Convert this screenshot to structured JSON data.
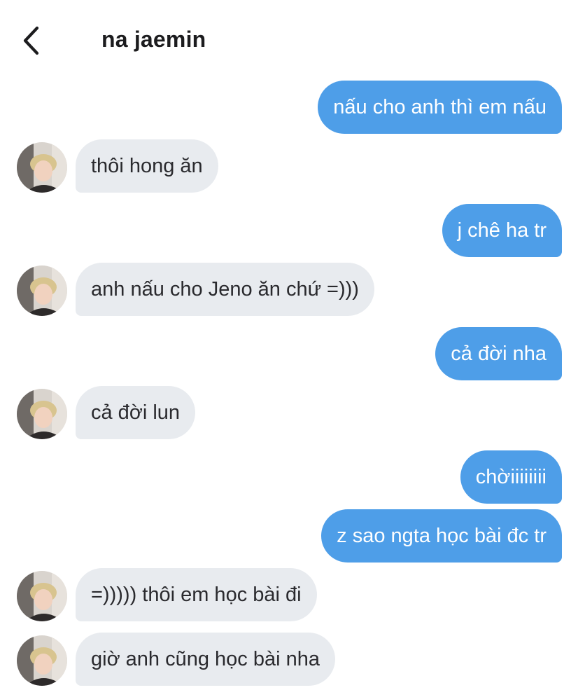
{
  "header": {
    "title": "na jaemin",
    "back_icon": "chevron-left-icon"
  },
  "colors": {
    "sent_bubble": "#4e9ee8",
    "received_bubble": "#e8ebef",
    "sent_text": "#ffffff",
    "received_text": "#2a2a2e"
  },
  "messages": [
    {
      "from": "me",
      "text": "nấu cho anh thì em nấu"
    },
    {
      "from": "contact",
      "text": "thôi hong ăn"
    },
    {
      "from": "me",
      "text": "j chê ha tr"
    },
    {
      "from": "contact",
      "text": "anh nấu cho Jeno ăn chứ =)))"
    },
    {
      "from": "me",
      "text": "cả đời nha"
    },
    {
      "from": "contact",
      "text": "cả đời lun"
    },
    {
      "from": "me",
      "text": "chờiiiiiiii"
    },
    {
      "from": "me",
      "text": "z sao ngta học bài đc tr"
    },
    {
      "from": "contact",
      "text": "=))))) thôi em học bài đi"
    },
    {
      "from": "contact",
      "text": "giờ anh cũng học bài nha"
    }
  ]
}
